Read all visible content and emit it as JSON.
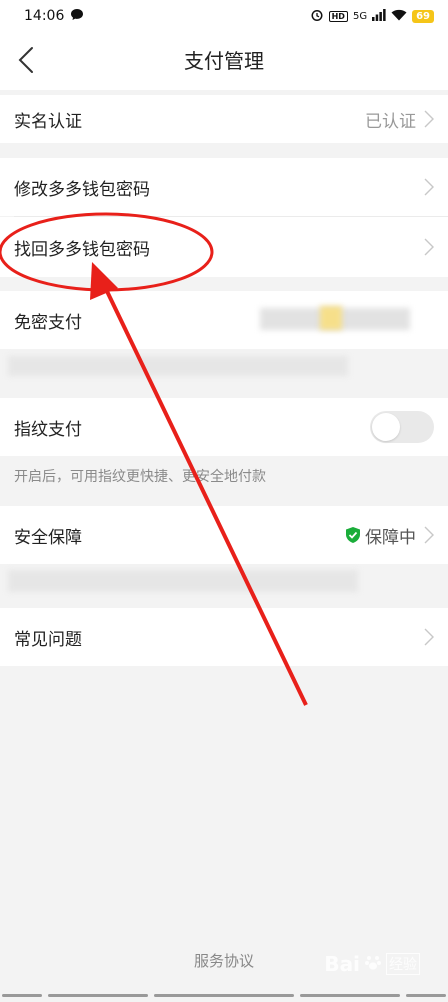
{
  "status_bar": {
    "time": "14:06",
    "network": "5G",
    "battery": "69"
  },
  "nav": {
    "title": "支付管理"
  },
  "rows": {
    "real_name": {
      "label": "实名认证",
      "value": "已认证"
    },
    "change_password": {
      "label": "修改多多钱包密码"
    },
    "recover_password": {
      "label": "找回多多钱包密码"
    },
    "password_free": {
      "label": "免密支付"
    },
    "fingerprint": {
      "label": "指纹支付",
      "hint": "开启后，可用指纹更快捷、更安全地付款",
      "enabled": false
    },
    "security": {
      "label": "安全保障",
      "value": "保障中"
    },
    "faq": {
      "label": "常见问题"
    }
  },
  "footer": {
    "service_agreement": "服务协议"
  },
  "watermark": {
    "brand": "Bai",
    "suffix": "经验"
  },
  "colors": {
    "accent_green": "#1aad3a",
    "annotation_red": "#e8201a",
    "background": "#f3f3f3",
    "row_background": "#ffffff"
  }
}
